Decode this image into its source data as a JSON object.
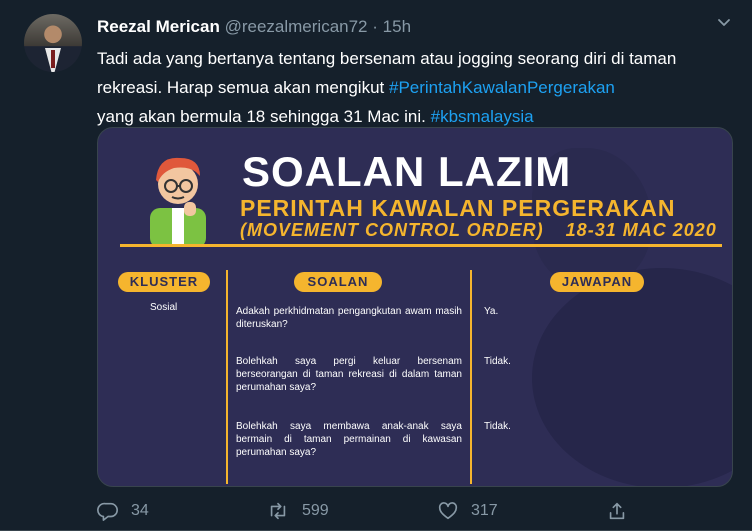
{
  "tweet": {
    "author_name": "Reezal Merican",
    "handle": "@reezalmerican72",
    "separator": "·",
    "time": "15h",
    "text_part1": "Tadi ada yang bertanya tentang bersenam atau jogging seorang diri di taman rekreasi. Harap semua akan mengikut ",
    "hashtag1": "#PerintahKawalanPergerakan",
    "text_part2": " yang akan bermula 18 sehingga 31 Mac ini. ",
    "hashtag2": "#kbsmalaysia"
  },
  "card": {
    "title": "SOALAN LAZIM",
    "subtitle": "PERINTAH KAWALAN PERGERAKAN",
    "subtitle_en": "(MOVEMENT CONTROL ORDER)",
    "date_range": "18-31 MAC 2020",
    "headers": {
      "cluster": "KLUSTER",
      "question": "SOALAN",
      "answer": "JAWAPAN"
    },
    "cluster_value": "Sosial",
    "rows": [
      {
        "question": "Adakah perkhidmatan pengangkutan awam masih diteruskan?",
        "answer": "Ya."
      },
      {
        "question": "Bolehkah saya pergi keluar bersenam berseorangan di taman rekreasi di dalam taman perumahan saya?",
        "answer": "Tidak."
      },
      {
        "question": "Bolehkah saya membawa anak-anak saya bermain di taman permainan di kawasan perumahan saya?",
        "answer": "Tidak."
      }
    ]
  },
  "actions": {
    "reply_count": "34",
    "retweet_count": "599",
    "like_count": "317"
  },
  "colors": {
    "background": "#15202b",
    "accent": "#1da1f2",
    "card_bg": "#2e2d55",
    "card_accent": "#f5b52e",
    "muted": "#8899a6"
  },
  "icons": [
    "chevron-down-icon",
    "reply-icon",
    "retweet-icon",
    "like-icon",
    "share-icon"
  ]
}
